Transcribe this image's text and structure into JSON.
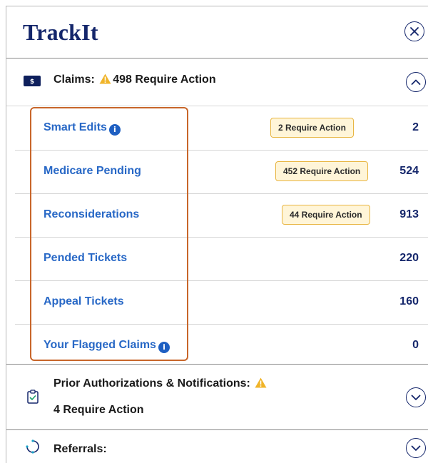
{
  "app": {
    "title": "TrackIt"
  },
  "claims": {
    "label": "Claims:",
    "alert": "498 Require Action",
    "items": [
      {
        "label": "Smart Edits",
        "info": true,
        "badge": "2 Require Action",
        "count": "2"
      },
      {
        "label": "Medicare Pending",
        "info": false,
        "badge": "452 Require Action",
        "count": "524"
      },
      {
        "label": "Reconsiderations",
        "info": false,
        "badge": "44 Require Action",
        "count": "913"
      },
      {
        "label": "Pended Tickets",
        "info": false,
        "badge": "",
        "count": "220"
      },
      {
        "label": "Appeal Tickets",
        "info": false,
        "badge": "",
        "count": "160"
      },
      {
        "label": "Your Flagged Claims",
        "info": true,
        "badge": "",
        "count": "0"
      }
    ]
  },
  "prior_auth": {
    "label": "Prior Authorizations & Notifications:",
    "alert": "4 Require Action"
  },
  "referrals": {
    "label": "Referrals:"
  },
  "icons": {
    "close": "close-icon",
    "claims": "money-icon",
    "warning": "warning-icon",
    "info": "info-icon",
    "clipboard": "clipboard-check-icon",
    "referral": "refresh-circle-icon",
    "chevron_up": "chevron-up-icon",
    "chevron_down": "chevron-down-icon"
  },
  "colors": {
    "brand_navy": "#14266b",
    "link_blue": "#2868c6",
    "badge_bg": "#fff5d8",
    "badge_border": "#e8b541",
    "warning": "#f0b429",
    "highlight": "#c8662a"
  }
}
